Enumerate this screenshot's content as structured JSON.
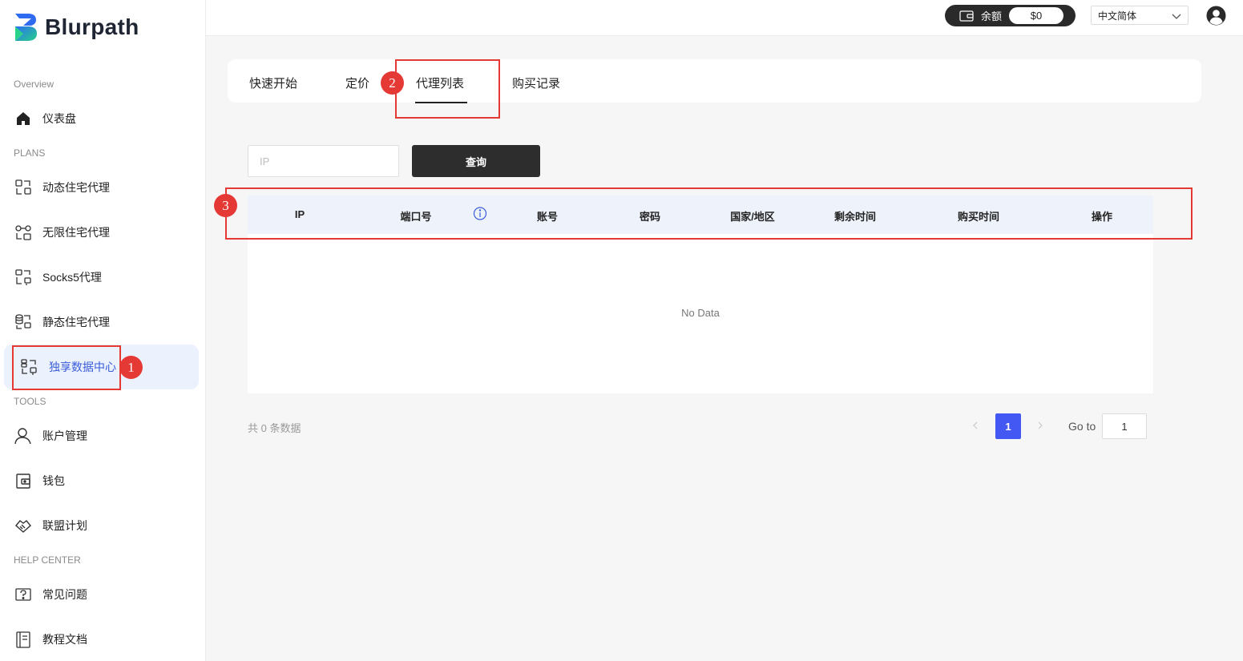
{
  "brand": {
    "name": "Blurpath"
  },
  "sidebar": {
    "sections": {
      "overview": "Overview",
      "plans": "PLANS",
      "tools": "TOOLS",
      "help": "HELP CENTER"
    },
    "items": [
      {
        "label": "仪表盘",
        "icon": "home-icon"
      },
      {
        "label": "动态住宅代理",
        "icon": "rotating-proxy-icon"
      },
      {
        "label": "无限住宅代理",
        "icon": "unlimited-proxy-icon"
      },
      {
        "label": "Socks5代理",
        "icon": "socks5-icon"
      },
      {
        "label": "静态住宅代理",
        "icon": "static-proxy-icon"
      },
      {
        "label": "独享数据中心",
        "icon": "datacenter-icon",
        "active": true
      },
      {
        "label": "账户管理",
        "icon": "user-icon"
      },
      {
        "label": "钱包",
        "icon": "wallet-icon"
      },
      {
        "label": "联盟计划",
        "icon": "handshake-icon"
      },
      {
        "label": "常见问题",
        "icon": "faq-icon"
      },
      {
        "label": "教程文档",
        "icon": "docs-icon"
      }
    ]
  },
  "header": {
    "balance_label": "余额",
    "balance_amount": "$0",
    "language": "中文简体"
  },
  "tabs": [
    {
      "label": "快速开始"
    },
    {
      "label": "定价"
    },
    {
      "label": "代理列表",
      "active": true
    },
    {
      "label": "购买记录"
    }
  ],
  "search": {
    "placeholder": "IP",
    "button_label": "查询"
  },
  "table": {
    "columns": [
      "IP",
      "端口号",
      "账号",
      "密码",
      "国家/地区",
      "剩余时间",
      "购买时间",
      "操作"
    ],
    "empty_text": "No Data"
  },
  "pagination": {
    "total_text": "共 0 条数据",
    "current_page": "1",
    "goto_label": "Go to",
    "goto_value": "1"
  },
  "annotations": [
    "1",
    "2",
    "3"
  ],
  "colors": {
    "accent": "#4357f2",
    "active_bg": "#ebf2fd",
    "active_text": "#3a5bd9",
    "annotation": "#e53935",
    "dark_button": "#2d2d2d"
  }
}
